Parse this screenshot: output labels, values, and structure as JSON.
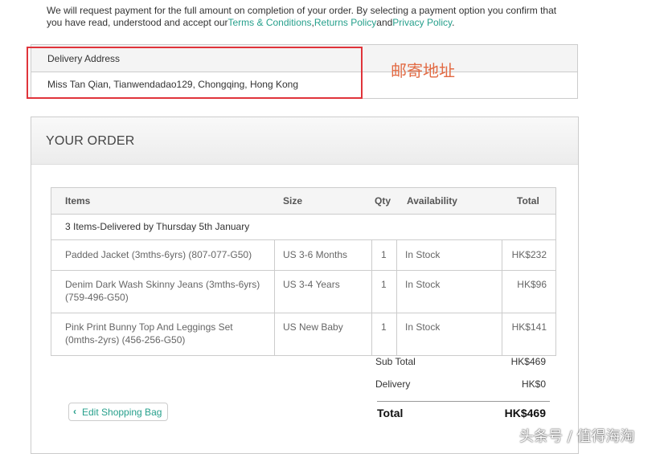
{
  "notice": {
    "text_before": "We will request payment for the full amount on completion of your order. By selecting a payment option you confirm that you have read, understood and accept our",
    "terms_link": "Terms & Conditions",
    "sep1": ",",
    "returns_link": "Returns Policy",
    "and_text": "and",
    "privacy_link": "Privacy Policy",
    "end": "."
  },
  "delivery": {
    "label": "Delivery Address",
    "address": "Miss Tan Qian, Tianwendadao129, Chongqing, Hong Kong"
  },
  "annotation": "邮寄地址",
  "order": {
    "title": "YOUR ORDER",
    "columns": {
      "items": "Items",
      "size": "Size",
      "qty": "Qty",
      "availability": "Availability",
      "total": "Total"
    },
    "delivery_note": "3 Items-Delivered by Thursday 5th January",
    "rows": [
      {
        "item": "Padded Jacket (3mths-6yrs) (807-077-G50)",
        "size": "US 3-6 Months",
        "qty": "1",
        "availability": "In Stock",
        "total": "HK$232"
      },
      {
        "item": "Denim Dark Wash Skinny Jeans (3mths-6yrs) (759-496-G50)",
        "size": "US 3-4 Years",
        "qty": "1",
        "availability": "In Stock",
        "total": "HK$96"
      },
      {
        "item": "Pink Print Bunny Top And Leggings Set (0mths-2yrs) (456-256-G50)",
        "size": "US New Baby",
        "qty": "1",
        "availability": "In Stock",
        "total": "HK$141"
      }
    ],
    "subtotal_label": "Sub Total",
    "subtotal_value": "HK$469",
    "delivery_label": "Delivery",
    "delivery_value": "HK$0",
    "total_label": "Total",
    "total_value": "HK$469",
    "edit_button": "Edit Shopping Bag",
    "accent_color": "#27a08c"
  },
  "watermark": "头条号 / 值得海淘"
}
